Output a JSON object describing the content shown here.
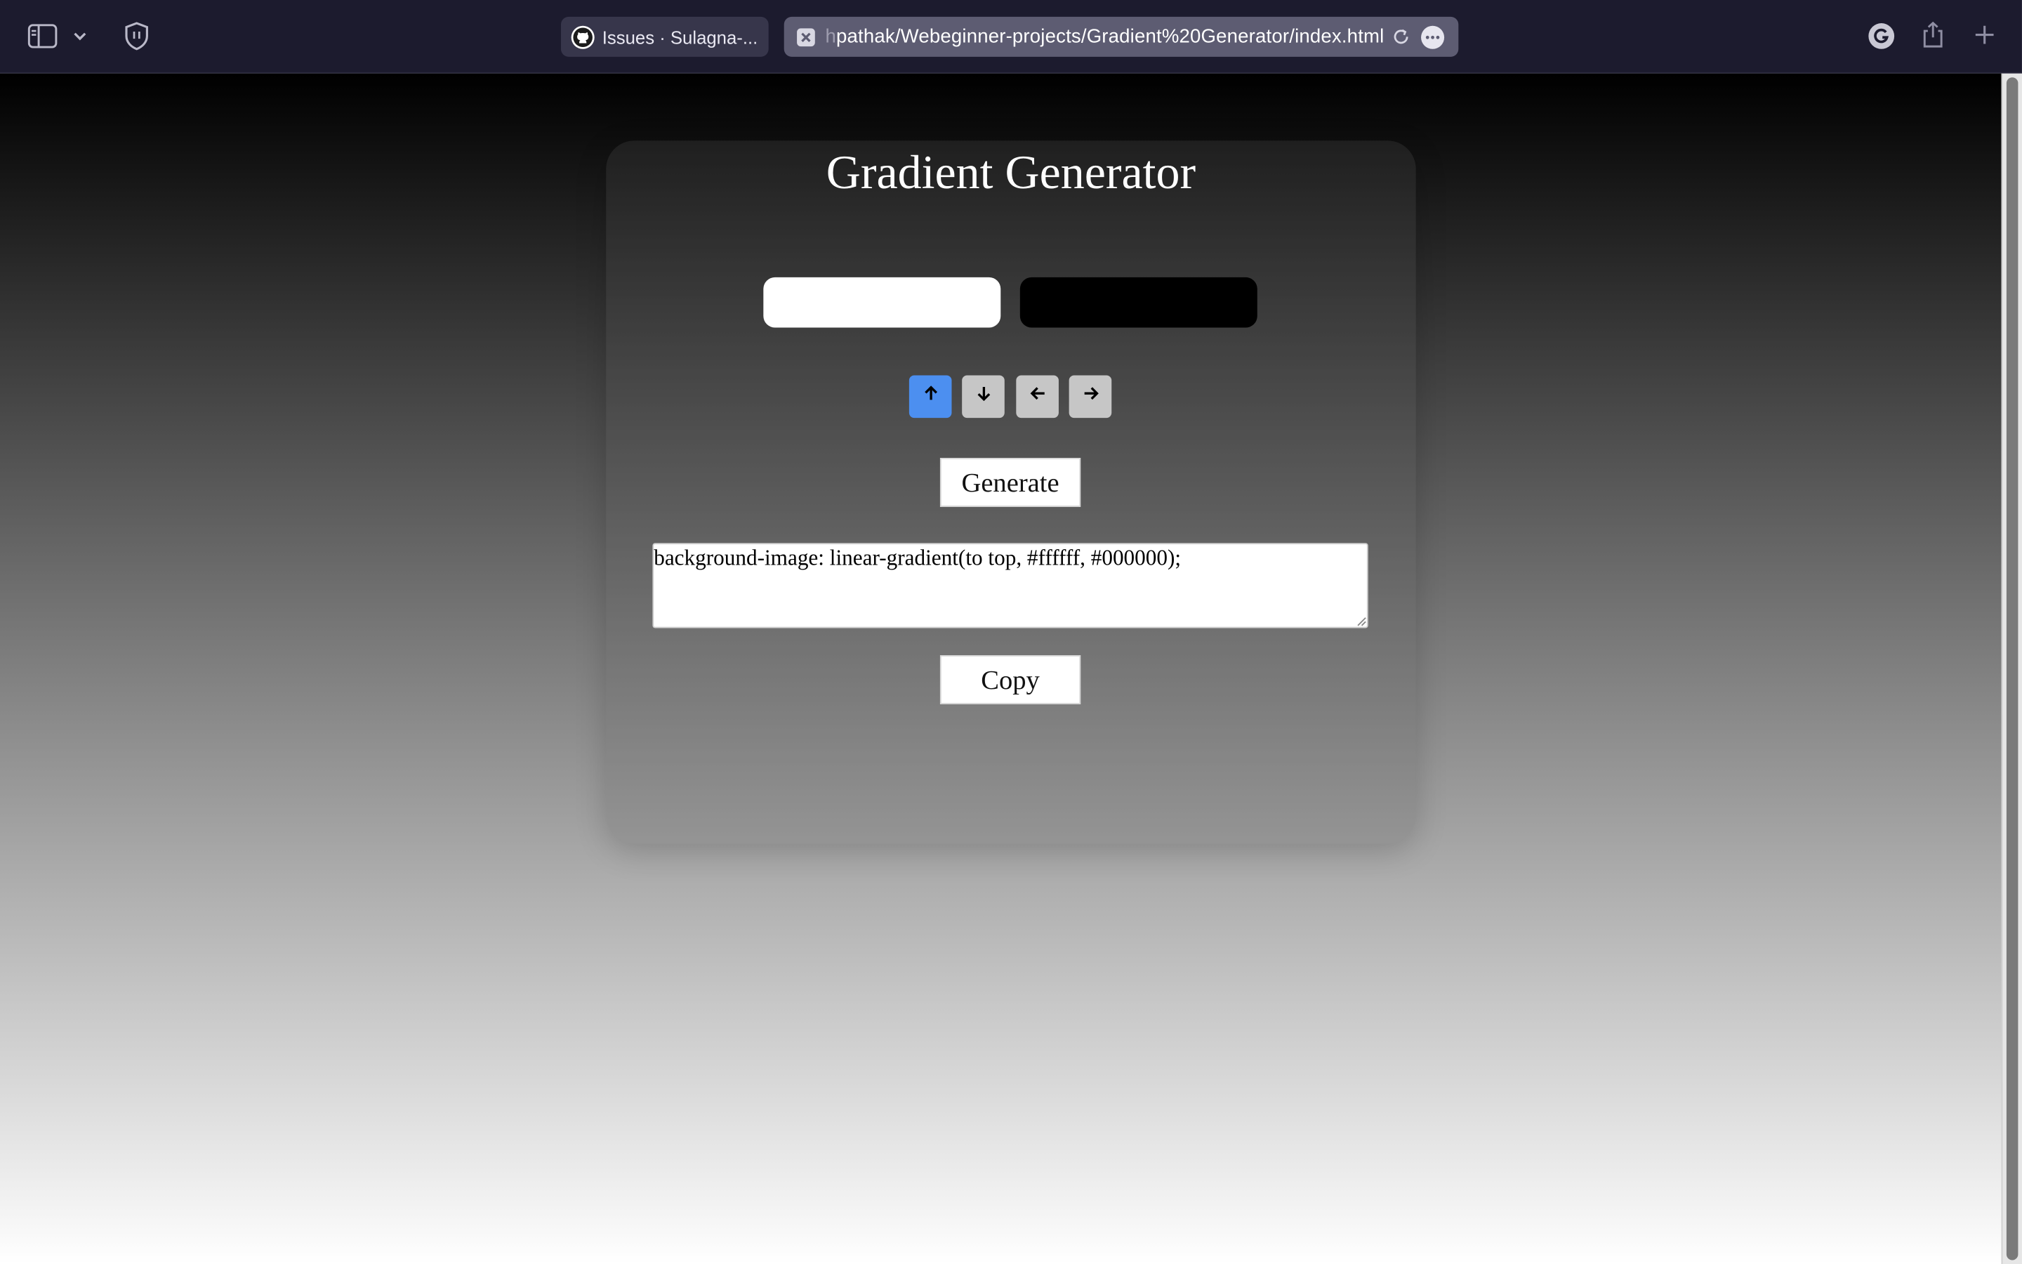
{
  "browser": {
    "inactive_tab_label": "Issues · Sulagna-...",
    "url": "pathak/Webeginner-projects/Gradient%20Generator/index.html",
    "url_faded_prefix": "h"
  },
  "app": {
    "title": "Gradient Generator",
    "color_1": "#ffffff",
    "color_2": "#000000",
    "directions": [
      {
        "name": "up",
        "icon": "arrow-up-icon",
        "active": true
      },
      {
        "name": "down",
        "icon": "arrow-down-icon",
        "active": false
      },
      {
        "name": "left",
        "icon": "arrow-left-icon",
        "active": false
      },
      {
        "name": "right",
        "icon": "arrow-right-icon",
        "active": false
      }
    ],
    "generate_label": "Generate",
    "output_value": "background-image: linear-gradient(to top, #ffffff, #000000);",
    "copy_label": "Copy"
  },
  "colors": {
    "active_direction": "#4c8ff0",
    "inactive_direction": "#c6c6c6",
    "toolbar": "#1c1b2e"
  }
}
